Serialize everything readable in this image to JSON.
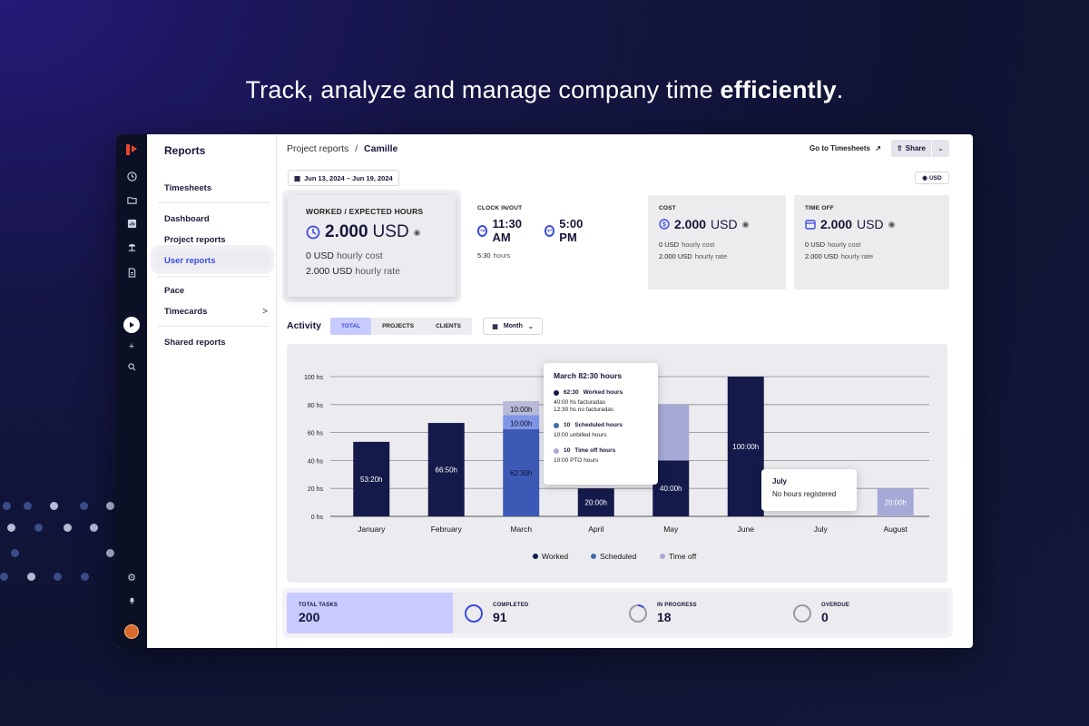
{
  "hero": {
    "lead": "Track, analyze and manage company time ",
    "bold": "efficiently",
    "tail": "."
  },
  "sidebar": {
    "title": "Reports",
    "items": [
      {
        "label": "Timesheets"
      },
      {
        "label": "Dashboard"
      },
      {
        "label": "Project reports"
      },
      {
        "label": "User reports",
        "active": true
      },
      {
        "label": "Pace"
      },
      {
        "label": "Timecards"
      },
      {
        "label": "Shared reports"
      }
    ],
    "timecards_chevron": ">"
  },
  "header": {
    "breadcrumb_parent": "Project reports",
    "breadcrumb_sep": "/",
    "breadcrumb_current": "Camille",
    "goto_label": "Go to Timesheets",
    "share_label": "Share",
    "date_range": "Jun 13, 2024 – Jun 19, 2024",
    "currency": "USD"
  },
  "cards": {
    "worked": {
      "caption": "WORKED / EXPECTED HOURS",
      "value": "2.000",
      "unit": "USD",
      "cost_value": "0 USD",
      "cost_label": "hourly cost",
      "rate_value": "2.000 USD",
      "rate_label": "hourly rate"
    },
    "clock": {
      "caption": "CLOCK IN/OUT",
      "in": "11:30 AM",
      "out": "5:00 PM",
      "hours_value": "5:30",
      "hours_label": "hours"
    },
    "cost": {
      "caption": "COST",
      "value": "2.000",
      "unit": "USD",
      "cost_value": "0 USD",
      "cost_label": "hourly cost",
      "rate_value": "2.000 USD",
      "rate_label": "hourly rate"
    },
    "timeoff": {
      "caption": "TIME OFF",
      "value": "2.000",
      "unit": "USD",
      "cost_value": "0 USD",
      "cost_label": "hourly cost",
      "rate_value": "2.000 USD",
      "rate_label": "hourly rate"
    }
  },
  "activity": {
    "title": "Activity",
    "tabs": [
      "TOTAL",
      "PROJECTS",
      "CLIENTS"
    ],
    "active_tab": "TOTAL",
    "period": "Month"
  },
  "chart_data": {
    "type": "bar",
    "stacked": true,
    "categories": [
      "January",
      "February",
      "March",
      "April",
      "May",
      "June",
      "July",
      "August"
    ],
    "yticks": [
      "0 hs",
      "20 hs",
      "40 hs",
      "60 hs",
      "80 hs",
      "100 hs"
    ],
    "ylim": [
      0,
      100
    ],
    "grid": true,
    "legend_position": "bottom",
    "series": [
      {
        "name": "Worked",
        "color": "#141a4a",
        "values": [
          53.33,
          66.83,
          62.5,
          20,
          40,
          100,
          0,
          0
        ],
        "labels": [
          "53:20h",
          "66:50h",
          "62:30h",
          "20:00h",
          "40:00h",
          "100:00h",
          "",
          ""
        ]
      },
      {
        "name": "Scheduled",
        "color": "#3d5ab8",
        "values": [
          0,
          0,
          10,
          0,
          0,
          0,
          0,
          0
        ],
        "labels": [
          "",
          "",
          "10:00h",
          "",
          "",
          "",
          "",
          ""
        ]
      },
      {
        "name": "Time off",
        "color": "#a6a9d6",
        "values": [
          0,
          0,
          10,
          0,
          40,
          0,
          0,
          20
        ],
        "labels": [
          "",
          "",
          "10:00h",
          "",
          "",
          "",
          "",
          "20:00h"
        ]
      }
    ],
    "highlight_colors": {
      "march_worked": "#3c5ab5",
      "march_scheduled": "#7f95e6",
      "march_timeoff": "#b9bbd9"
    }
  },
  "tooltip_march": {
    "title": "March 82:30 hours",
    "worked_value": "62:30",
    "worked_label": "Worked hours",
    "worked_sub1": "40:00 hs facturadas",
    "worked_sub2": "12:30 hs no facturadas",
    "scheduled_value": "10",
    "scheduled_label": "Scheduled hours",
    "scheduled_sub": "10:00 unbilled hours",
    "timeoff_value": "10",
    "timeoff_label": "Time off hours",
    "timeoff_sub": "10:00 PTO hours"
  },
  "tooltip_july": {
    "title": "July",
    "text": "No hours registered"
  },
  "tasks": {
    "total": {
      "label": "TOTAL TASKS",
      "value": "200"
    },
    "completed": {
      "label": "COMPLETED",
      "value": "91"
    },
    "in_progress": {
      "label": "IN PROGRESS",
      "value": "18"
    },
    "overdue": {
      "label": "OVERDUE",
      "value": "0"
    }
  },
  "colors": {
    "accent": "#3d4ae0",
    "rail": "#0c1024",
    "worked": "#141a4a",
    "scheduled": "#3d5ab8",
    "timeoff": "#a6a9d6"
  }
}
